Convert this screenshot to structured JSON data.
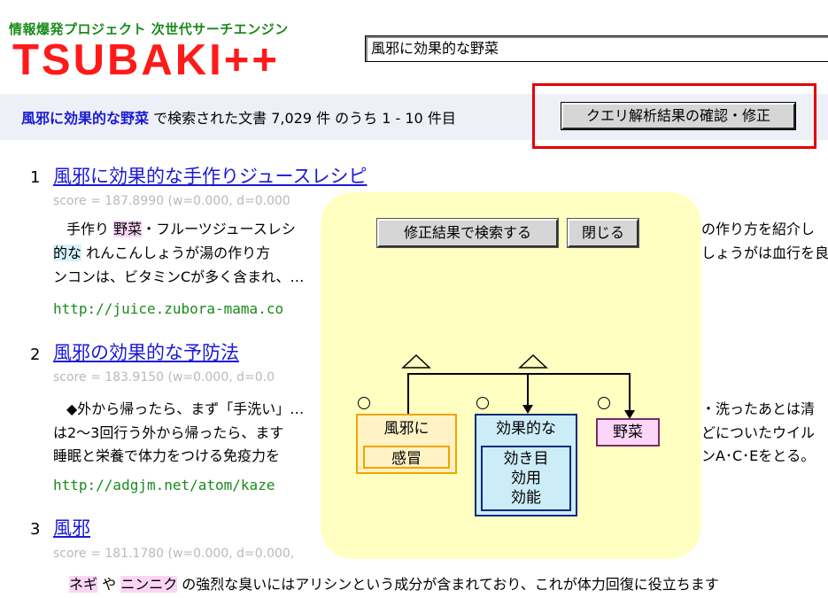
{
  "header": {
    "subtitle": "情報爆発プロジェクト 次世代サーチエンジン",
    "logo": "TSUBAKI++",
    "search_value": "風邪に効果的な野菜"
  },
  "summary": {
    "query": "風邪に効果的な野菜",
    "text": " で検索された文書 7,029 件 のうち 1 - 10 件目",
    "confirm_button": "クエリ解析結果の確認・修正"
  },
  "results": [
    {
      "num": "1",
      "title": "風邪に効果的な手作りジュースレシピ",
      "score": "score = 187.8990 (w=0.000, d=0.000",
      "line1": [
        "手作り ",
        "野菜",
        "・フルーツジュースレシ",
        "",
        "の作り方を紹介し"
      ],
      "line2": [
        "的な",
        " れんこんしょうが湯の作り方",
        "しょうがは血行を良"
      ],
      "line3": "ンコンは、ビタミンCが多く含まれ、…",
      "url": "http://juice.zubora-mama.co"
    },
    {
      "num": "2",
      "title": "風邪の効果的な予防法",
      "score": "score = 183.9150 (w=0.000, d=0.0",
      "line1": [
        "◆外から帰ったら、まず「手洗い」…",
        "・洗ったあとは清"
      ],
      "line2": [
        "は2～3回行う外から帰ったら、ます",
        "どについたウイル"
      ],
      "line3": [
        "睡眠と栄養で体力をつける免疫力を",
        "ンA･C･Eをとる。"
      ],
      "url": "http://adgjm.net/atom/kaze"
    },
    {
      "num": "3",
      "title": "風邪",
      "score": "score = 181.1780 (w=0.000, d=0.000,",
      "line1": [
        "ネギ",
        " や ",
        "ニンニク",
        " の強烈な臭いにはアリシンという成分が含まれており、これが体力回復に役立ちます"
      ]
    }
  ],
  "panel": {
    "search_fixed_button": "修正結果で検索する",
    "close_button": "閉じる",
    "node1": {
      "head": "風邪に",
      "sub": "感冒"
    },
    "node2": {
      "head": "効果的な",
      "subs": [
        "効き目",
        "効用",
        "効能"
      ]
    },
    "node3": {
      "head": "野菜"
    }
  },
  "colors": {
    "logo": "#ff1a1a",
    "link": "#1a1ad6",
    "url": "#1a8a1a",
    "highlight_box": "#e30000",
    "panel_bg": "#ffffc2"
  }
}
